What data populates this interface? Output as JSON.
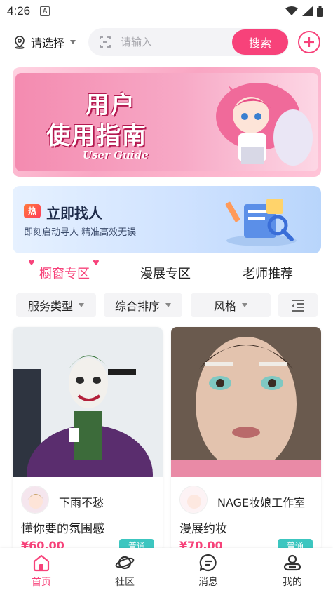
{
  "status_bar": {
    "time": "4:26",
    "indicator": "A"
  },
  "header": {
    "location_label": "请选择",
    "search_placeholder": "请输入",
    "search_button": "搜索"
  },
  "banner_guide": {
    "title_line1": "用户",
    "title_line2": "使用指南",
    "subtitle": "User Guide"
  },
  "banner_find": {
    "badge": "热",
    "title": "立即找人",
    "subtitle": "即刻启动寻人 精准高效无误"
  },
  "tabs": [
    {
      "label": "橱窗专区",
      "active": true
    },
    {
      "label": "漫展专区",
      "active": false
    },
    {
      "label": "老师推荐",
      "active": false
    }
  ],
  "filters": [
    {
      "label": "服务类型"
    },
    {
      "label": "综合排序"
    },
    {
      "label": "风格"
    }
  ],
  "cards": [
    {
      "user": "下雨不愁",
      "title": "懂你要的氛围感",
      "price": "¥60.00",
      "tag": "普通"
    },
    {
      "user": "NAGE妆娘工作室",
      "title": "漫展约妆",
      "price": "¥70.00",
      "tag": "普通"
    }
  ],
  "bottom_nav": [
    {
      "label": "首页",
      "icon": "home-icon",
      "active": true
    },
    {
      "label": "社区",
      "icon": "planet-icon",
      "active": false
    },
    {
      "label": "消息",
      "icon": "message-icon",
      "active": false
    },
    {
      "label": "我的",
      "icon": "profile-icon",
      "active": false
    }
  ],
  "colors": {
    "accent": "#f7427a",
    "tag": "#3cc6c0"
  }
}
